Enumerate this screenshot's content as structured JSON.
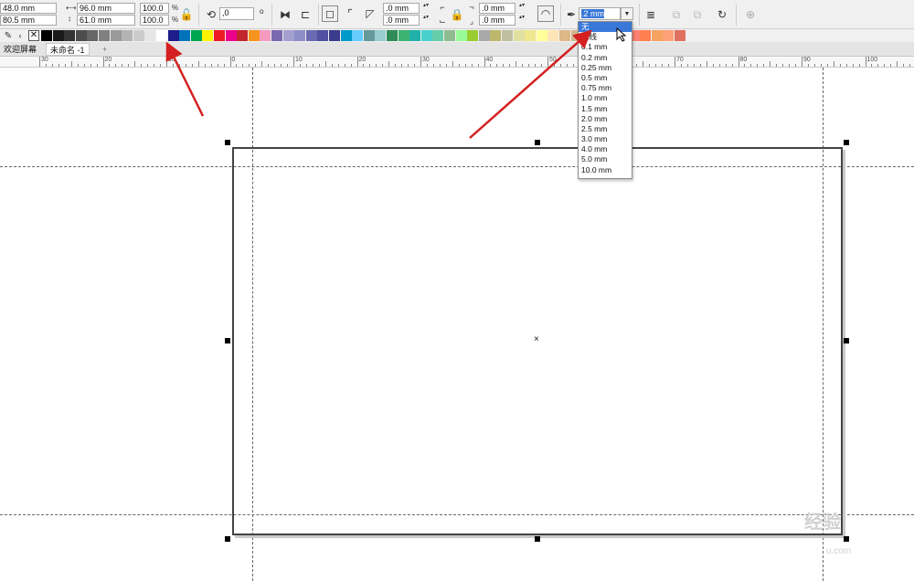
{
  "toolbar": {
    "pos_x": "48.0 mm",
    "pos_y": "80.5 mm",
    "width": "96.0 mm",
    "height": "61.0 mm",
    "scale_x": "100.0",
    "scale_y": "100.0",
    "percent": "%",
    "rotation": ",0",
    "degree": "o",
    "corner_radius_1": ".0 mm",
    "corner_radius_2": ".0 mm",
    "corner_radius_3": ".0 mm",
    "corner_radius_4": ".0 mm",
    "outline_width": ".2 mm"
  },
  "outline_dropdown": {
    "options": [
      "无",
      "细线",
      "0.1 mm",
      "0.2 mm",
      "0.25 mm",
      "0.5 mm",
      "0.75 mm",
      "1.0 mm",
      "1.5 mm",
      "2.0 mm",
      "2.5 mm",
      "3.0 mm",
      "4.0 mm",
      "5.0 mm",
      "10.0 mm"
    ],
    "selected_index": 0
  },
  "tabs": {
    "welcome": "欢迎屏幕",
    "document": "未命名 -1",
    "add": "+"
  },
  "ruler": {
    "labels": [
      "30",
      "20",
      "10",
      "0",
      "10",
      "20",
      "30",
      "40",
      "50",
      "60",
      "70",
      "80",
      "90",
      "100"
    ]
  },
  "palette": {
    "colors": [
      "#000000",
      "#1a1a1a",
      "#333333",
      "#4d4d4d",
      "#666666",
      "#808080",
      "#999999",
      "#b3b3b3",
      "#cccccc",
      "#e6e6e6",
      "#ffffff",
      "#1d1d8c",
      "#0072bc",
      "#00a651",
      "#fff200",
      "#ed1c24",
      "#ec008c",
      "#c1272d",
      "#f7941d",
      "#f49ac1",
      "#7b68ae",
      "#a3a0d0",
      "#8c8cc8",
      "#6a6ab4",
      "#5050a0",
      "#3c3c8c",
      "#0099cc",
      "#66ccff",
      "#669999",
      "#99cccc",
      "#2e8b57",
      "#3cb371",
      "#20b2aa",
      "#48d1cc",
      "#66cdaa",
      "#8fbc8f",
      "#98fb98",
      "#9acd32",
      "#a9a9a9",
      "#bdb76b",
      "#c0c0a0",
      "#e0e0a0",
      "#f0e68c",
      "#ffff99",
      "#ffe4b5",
      "#deb887",
      "#d2b48c",
      "#cd853f",
      "#d2691e",
      "#e9967a",
      "#f08080",
      "#fa8072",
      "#ff7f50",
      "#f4a460",
      "#ffa07a",
      "#e07060"
    ]
  },
  "watermark": {
    "main": "经验",
    "sub": "u.com"
  }
}
